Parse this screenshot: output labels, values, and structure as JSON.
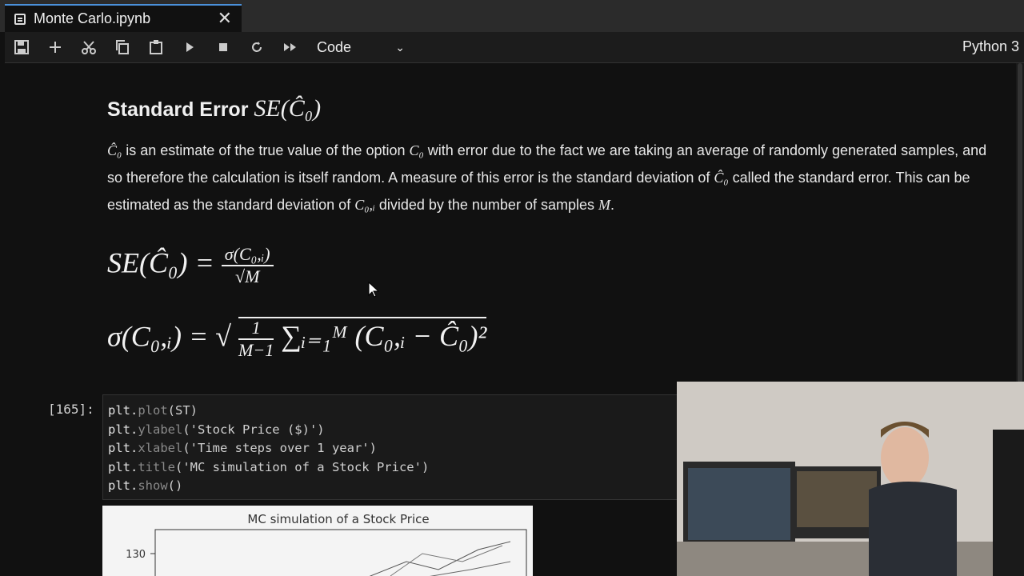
{
  "tab": {
    "title": "Monte Carlo.ipynb",
    "close": "✕"
  },
  "toolbar": {
    "buttons": [
      {
        "name": "save-icon"
      },
      {
        "name": "add-cell-icon"
      },
      {
        "name": "cut-icon"
      },
      {
        "name": "copy-icon"
      },
      {
        "name": "paste-icon"
      },
      {
        "name": "run-icon"
      },
      {
        "name": "stop-icon"
      },
      {
        "name": "restart-icon"
      },
      {
        "name": "fast-forward-icon"
      }
    ],
    "cell_type": "Code",
    "kernel": "Python 3"
  },
  "markdown": {
    "heading_text": "Standard Error",
    "heading_math": "SE(Ĉ₀)",
    "para_1a": "Ĉ₀",
    "para_1b": " is an estimate of the true value of the option ",
    "para_1c": "C₀",
    "para_1d": " with error due to the fact we are taking an average of randomly generated samples, and so therefore the calculation is itself random. A measure of this error is the standard deviation of ",
    "para_1e": "Ĉ₀",
    "para_1f": " called the standard error. This can be estimated as the standard deviation of ",
    "para_1g": "C₀,ᵢ",
    "para_1h": " divided by the number of samples ",
    "para_1i": "M",
    "para_1j": "."
  },
  "equations": {
    "eq1_lhs": "SE(Ĉ₀) =",
    "eq1_num": "σ(C₀,ᵢ)",
    "eq1_den": "√M",
    "eq2_lhs": "σ(C₀,ᵢ) = √",
    "eq2_num": "1",
    "eq2_den": "M−1",
    "eq2_rhs": "∑ᵢ₌₁ᴹ (C₀,ᵢ − Ĉ₀)²"
  },
  "code_cell": {
    "prompt": "[165]:",
    "lines": [
      [
        "plt.",
        "plot",
        "(ST)"
      ],
      [
        "plt.",
        "ylabel",
        "('Stock Price ($)')"
      ],
      [
        "plt.",
        "xlabel",
        "('Time steps over 1 year')"
      ],
      [
        "plt.",
        "title",
        "('MC simulation of a Stock Price')"
      ],
      [
        "plt.",
        "show",
        "()"
      ]
    ]
  },
  "chart_data": {
    "type": "line",
    "title": "MC simulation of a Stock Price",
    "yticks": [
      130
    ]
  }
}
